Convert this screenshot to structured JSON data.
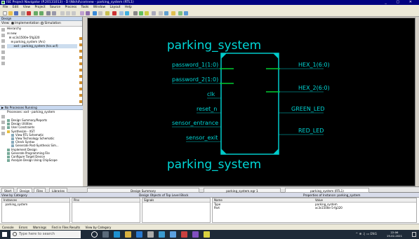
{
  "window": {
    "title": "ISE Project Navigator (P.20131013) - D:\\Nikhil\\cse\\new - parking_system (RTL1)"
  },
  "menu": [
    "File",
    "Edit",
    "View",
    "Project",
    "Source",
    "Process",
    "Tools",
    "Window",
    "Layout",
    "Help"
  ],
  "design_panel": {
    "header": "Design",
    "view_label": "View:",
    "view_opts": [
      "Implementation",
      "Simulation"
    ],
    "hierarchy_label": "Hierarchy",
    "tree": [
      "new",
      "xc3s1500e-5fg320",
      "parking_system (Arc)",
      "xxd - parking_system (tcs.ucf)"
    ]
  },
  "processes": {
    "header": "No Processes Running",
    "title": "Processes: xxd - parking_system",
    "items": [
      "Design Summary/Reports",
      "Design Utilities",
      "User Constraints",
      "Synthesize - XST",
      "View RTL Schematic",
      "View Technology Schematic",
      "Check Syntax",
      "Generate Post-Synthesis Sim...",
      "Implement Design",
      "Generate Programming File",
      "Configure Target Device",
      "Analyze Design Using ChipScope"
    ]
  },
  "schematic": {
    "top_label": "parking_system",
    "bottom_label": "parking_system",
    "inputs": [
      "password_1(1:0)",
      "password_2(1:0)",
      "clk",
      "reset_n",
      "sensor_entrance",
      "sensor_exit"
    ],
    "outputs": [
      "HEX_1(6:0)",
      "HEX_2(6:0)",
      "GREEN_LED",
      "RED_LED"
    ]
  },
  "bottom_tabs": {
    "start": "Start",
    "design": "Design",
    "files": "Files",
    "libraries": "Libraries",
    "summary": "Design Summary",
    "rtl1": "parking_system.ngr 1",
    "rtl2": "parking_system (RTL1)"
  },
  "bottom_panel": {
    "header_left": "View by Category",
    "center_title": "Design Objects of Top Level Block",
    "right_title": "Properties of Instance: parking_system",
    "cols": {
      "instances": "Instances",
      "pins": "Pins",
      "signals": "Signals",
      "name": "Name",
      "value": "Value"
    },
    "instance_row": "parking_system",
    "props": [
      {
        "name": "Type",
        "value": "parking_system"
      },
      {
        "name": "Part",
        "value": "xc3s1500e-5-fg320"
      }
    ]
  },
  "console_tabs": [
    "Console",
    "Errors",
    "Warnings",
    "Find in Files Results",
    "View by Category"
  ],
  "taskbar": {
    "search_placeholder": "Type here to search",
    "time": "22:06",
    "date": "19-02-2021"
  },
  "colors": {
    "wire": "#00cc33",
    "box": "#00cccc",
    "text": "#00d8d8"
  }
}
